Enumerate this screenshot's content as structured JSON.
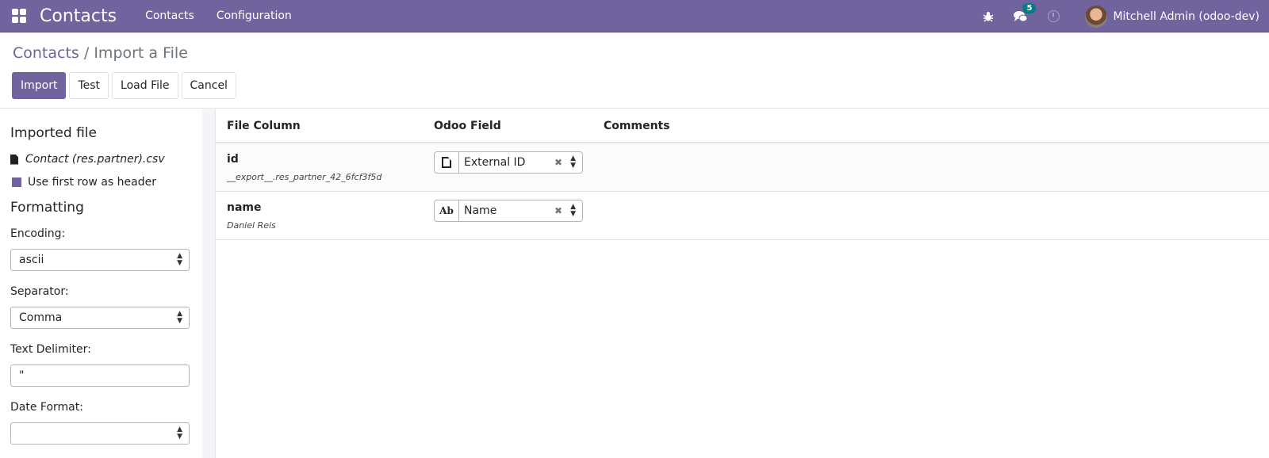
{
  "navbar": {
    "app_title": "Contacts",
    "menu": [
      "Contacts",
      "Configuration"
    ],
    "messages_count": "5",
    "user_name": "Mitchell Admin (odoo-dev)",
    "brand_color": "#71639e"
  },
  "control_panel": {
    "breadcrumb_parent": "Contacts",
    "breadcrumb_separator": "/",
    "breadcrumb_current": "Import a File",
    "buttons": {
      "import": "Import",
      "test": "Test",
      "load_file": "Load File",
      "cancel": "Cancel"
    }
  },
  "sidebar": {
    "imported_file_heading": "Imported file",
    "file_name": "Contact (res.partner).csv",
    "header_checkbox_label": "Use first row as header",
    "header_checkbox_checked": true,
    "formatting_heading": "Formatting",
    "encoding_label": "Encoding:",
    "encoding_value": "ascii",
    "separator_label": "Separator:",
    "separator_value": "Comma",
    "text_delimiter_label": "Text Delimiter:",
    "text_delimiter_value": "\"",
    "date_format_label": "Date Format:",
    "date_format_value": ""
  },
  "table": {
    "headers": [
      "File Column",
      "Odoo Field",
      "Comments"
    ],
    "rows": [
      {
        "column": "id",
        "sample": "__export__.res_partner_42_6fcf3f5d",
        "field_type_icon": "file-icon",
        "field": "External ID",
        "comment": ""
      },
      {
        "column": "name",
        "sample": "Daniel Reis",
        "field_type_icon": "text-ab-icon",
        "field_type_glyph": "Ab",
        "field": "Name",
        "comment": ""
      }
    ]
  }
}
